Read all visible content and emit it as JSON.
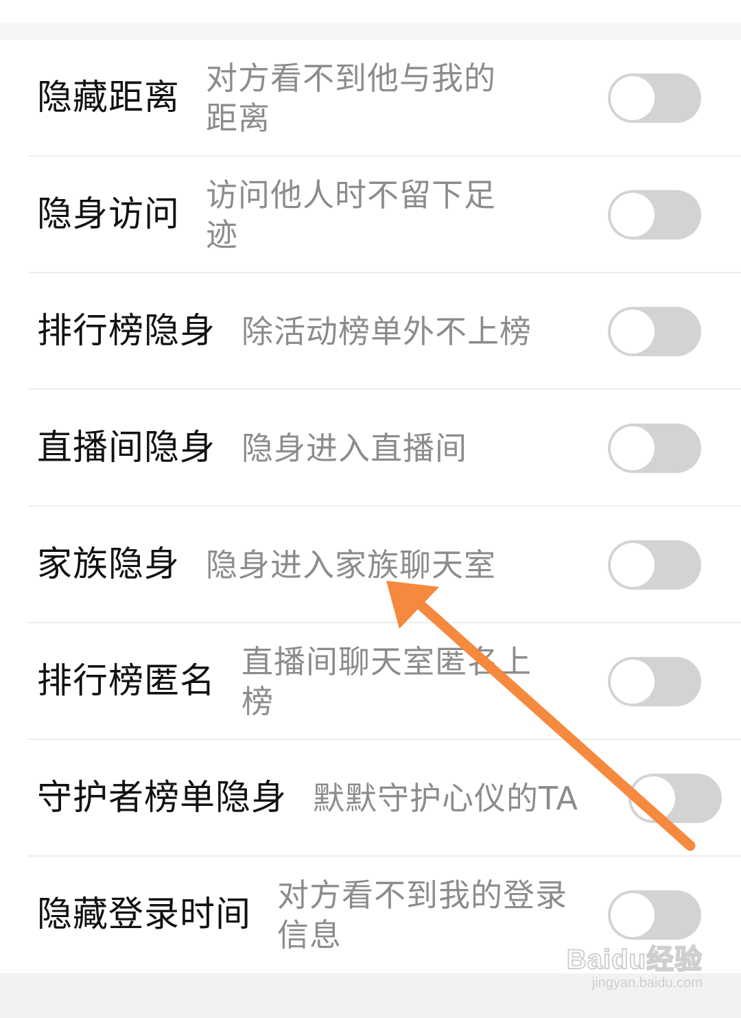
{
  "settings": [
    {
      "title": "隐藏距离",
      "desc": "对方看不到他与我的距离",
      "enabled": false
    },
    {
      "title": "隐身访问",
      "desc": "访问他人时不留下足迹",
      "enabled": false
    },
    {
      "title": "排行榜隐身",
      "desc": "除活动榜单外不上榜",
      "enabled": false
    },
    {
      "title": "直播间隐身",
      "desc": "隐身进入直播间",
      "enabled": false
    },
    {
      "title": "家族隐身",
      "desc": "隐身进入家族聊天室",
      "enabled": false
    },
    {
      "title": "排行榜匿名",
      "desc": "直播间聊天室匿名上榜",
      "enabled": false
    },
    {
      "title": "守护者榜单隐身",
      "desc": "默默守护心仪的TA",
      "enabled": false
    },
    {
      "title": "隐藏登录时间",
      "desc": "对方看不到我的登录信息",
      "enabled": false
    }
  ],
  "watermark": {
    "logo": "Baidu经验",
    "url": "jingyan.baidu.com"
  },
  "colors": {
    "title": "#111111",
    "description": "#8c8c8c",
    "toggle_off": "#d3d3d3",
    "annotation_arrow": "#f5893d"
  }
}
